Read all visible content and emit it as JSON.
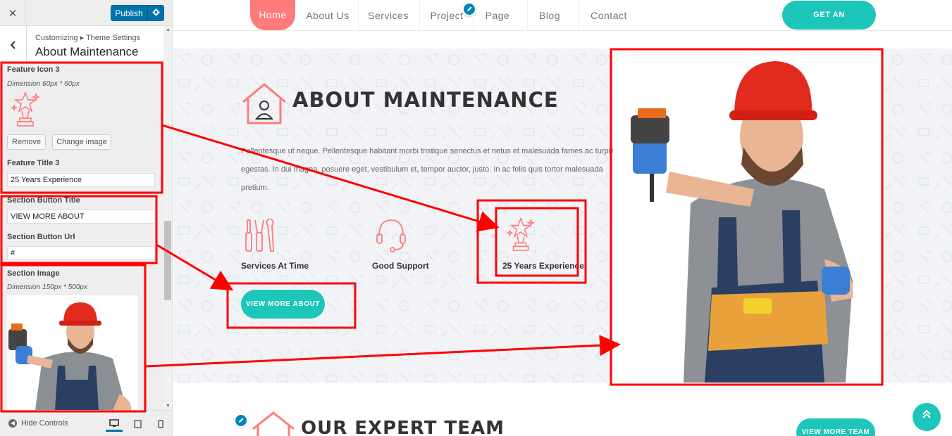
{
  "sidebar": {
    "close_icon": "close-icon",
    "publish_label": "Publish",
    "breadcrumb": "Customizing ▸ Theme Settings",
    "section_title": "About Maintenance",
    "feature_icon_label": "Feature Icon 3",
    "feature_icon_dimension": "Dimension 60px * 60px",
    "remove_label": "Remove",
    "change_image_label": "Change image",
    "feature_title_label": "Feature Title 3",
    "feature_title_value": "25 Years Experience",
    "button_title_label": "Section Button Title",
    "button_title_value": "VIEW MORE ABOUT",
    "button_url_label": "Section Button Url",
    "button_url_value": "#",
    "section_image_label": "Section Image",
    "section_image_dimension": "Dimension 150px * 500px",
    "hide_controls_label": "Hide Controls"
  },
  "nav": {
    "items": [
      "Home",
      "About Us",
      "Services",
      "Project",
      "Page",
      "Blog",
      "Contact"
    ],
    "cta": "GET AN APPOINTMENT"
  },
  "about": {
    "title": "ABOUT MAINTENANCE",
    "paragraph": "Pellentesque ut neque. Pellentesque habitant morbi tristique senectus et netus et malesuada fames ac turpis egestas. In dui magna, posuere eget, vestibulum et, tempor auctor, justo. In ac felis quis tortor malesuada pretium.",
    "features": [
      "Services At Time",
      "Good Support",
      "25 Years Experience"
    ],
    "button": "VIEW MORE ABOUT"
  },
  "team": {
    "title": "OUR EXPERT TEAM",
    "button": "VIEW MORE TEAM"
  },
  "colors": {
    "accent": "#1cc6b9",
    "coral": "#ff7a7a",
    "wp_blue": "#0073aa",
    "annotation_red": "#ff0000"
  }
}
